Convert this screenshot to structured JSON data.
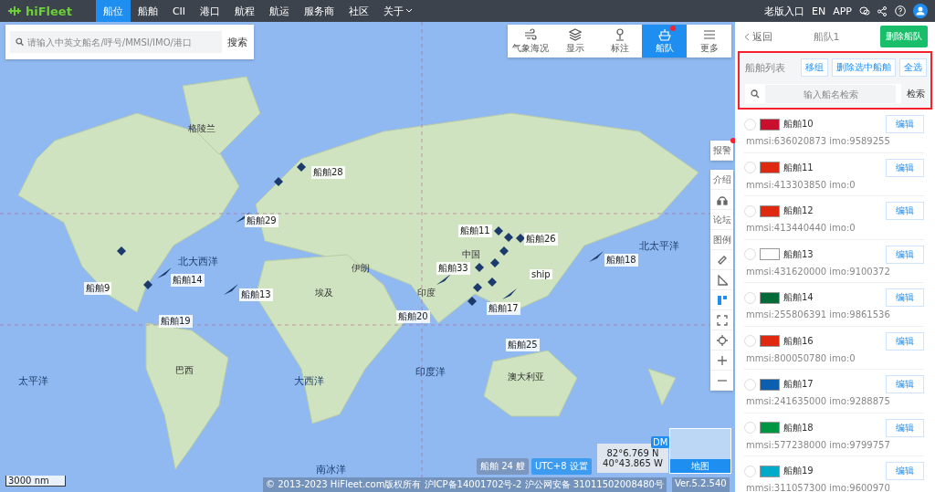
{
  "nav": {
    "logo": "hiFleet",
    "items": [
      {
        "label": "船位",
        "selected": true
      },
      {
        "label": "船舶",
        "selected": false
      },
      {
        "label": "CII",
        "selected": false
      },
      {
        "label": "港口",
        "selected": false
      },
      {
        "label": "航程",
        "selected": false
      },
      {
        "label": "航运",
        "selected": false
      },
      {
        "label": "服务商",
        "selected": false
      },
      {
        "label": "社区",
        "selected": false
      },
      {
        "label": "关于",
        "selected": false
      }
    ],
    "right": [
      "老版入口",
      "EN",
      "APP"
    ]
  },
  "search": {
    "placeholder": "请输入中英文船名/呼号/MMSI/IMO/港口",
    "button": "搜索"
  },
  "tools": [
    {
      "label": "气象海况",
      "selected": false,
      "badge": false
    },
    {
      "label": "显示",
      "selected": false,
      "badge": false
    },
    {
      "label": "标注",
      "selected": false,
      "badge": false
    },
    {
      "label": "船队",
      "selected": true,
      "badge": true
    },
    {
      "label": "更多",
      "selected": false,
      "badge": false
    }
  ],
  "map": {
    "labels": [
      {
        "text": "格陵兰",
        "kind": "land"
      },
      {
        "text": "北大西洋",
        "kind": "ocean"
      },
      {
        "text": "北太平洋",
        "kind": "ocean"
      },
      {
        "text": "太平洋",
        "kind": "ocean"
      },
      {
        "text": "大西洋",
        "kind": "ocean"
      },
      {
        "text": "印度洋",
        "kind": "ocean"
      },
      {
        "text": "南冰洋",
        "kind": "ocean"
      },
      {
        "text": "中国",
        "kind": "land"
      },
      {
        "text": "印度",
        "kind": "land"
      },
      {
        "text": "巴西",
        "kind": "land"
      },
      {
        "text": "澳大利亚",
        "kind": "land"
      },
      {
        "text": "伊朗",
        "kind": "land"
      },
      {
        "text": "埃及",
        "kind": "land"
      }
    ],
    "ships": [
      "船舶28",
      "船舶29",
      "船舶14",
      "船舶9",
      "船舶13",
      "船舶19",
      "船舶11",
      "船舶26",
      "船舶33",
      "ship",
      "船舶18",
      "船舶17",
      "船舶20",
      "船舶25"
    ],
    "side_tools": [
      {
        "label": "报警",
        "kind": "text",
        "badge": true,
        "selected": false
      },
      {
        "label": "介绍",
        "kind": "text",
        "badge": false,
        "selected": false
      },
      {
        "kind": "headset",
        "badge": false,
        "selected": false
      },
      {
        "label": "论坛",
        "kind": "text",
        "badge": false,
        "selected": false
      },
      {
        "label": "图例",
        "kind": "text",
        "badge": false,
        "selected": false
      },
      {
        "kind": "ruler",
        "badge": false,
        "selected": false
      },
      {
        "kind": "triangle",
        "badge": false,
        "selected": false
      },
      {
        "kind": "layout",
        "badge": false,
        "selected": true
      },
      {
        "kind": "expand",
        "badge": false,
        "selected": false
      },
      {
        "kind": "target",
        "badge": false,
        "selected": false
      },
      {
        "kind": "plus",
        "badge": false,
        "selected": false
      },
      {
        "kind": "minus",
        "badge": false,
        "selected": false
      }
    ],
    "scale": "3000 nm",
    "ship_count": "船舶 24 艘",
    "timezone": "UTC+8 设置",
    "coords": [
      "82°6.769 N",
      "40°43.865 W"
    ],
    "coord_mode": "DM",
    "minimap_label": "地图",
    "footer": "© 2013-2023 HiFleet.com版权所有 沪ICP备14001702号-2 沪公网安备 31011502008480号",
    "version": "Ver.5.2.540"
  },
  "panel": {
    "back": "返回",
    "title": "船队1",
    "delete": "删除船队",
    "list_title": "船舶列表",
    "actions": [
      "移组",
      "删除选中船舶",
      "全选"
    ],
    "search_placeholder": "输入船名检索",
    "search_button": "检索",
    "ships": [
      {
        "name": "船舶10",
        "info": "mmsi:636020873 imo:9589255",
        "edit": "编辑",
        "color": "#c8102e",
        "selected": false
      },
      {
        "name": "船舶11",
        "info": "mmsi:413303850 imo:0",
        "edit": "编辑",
        "color": "#de2910",
        "selected": false
      },
      {
        "name": "船舶12",
        "info": "mmsi:413440440 imo:0",
        "edit": "编辑",
        "color": "#de2910",
        "selected": false
      },
      {
        "name": "船舶13",
        "info": "mmsi:431620000 imo:9100372",
        "edit": "编辑",
        "color": "#ffffff",
        "selected": false
      },
      {
        "name": "船舶14",
        "info": "mmsi:255806391 imo:9861536",
        "edit": "编辑",
        "color": "#046a38",
        "selected": false
      },
      {
        "name": "船舶16",
        "info": "mmsi:800050780 imo:0",
        "edit": "编辑",
        "color": "#de2910",
        "selected": false
      },
      {
        "name": "船舶17",
        "info": "mmsi:241635000 imo:9288875",
        "edit": "编辑",
        "color": "#0d5eaf",
        "selected": false
      },
      {
        "name": "船舶18",
        "info": "mmsi:577238000 imo:9799757",
        "edit": "编辑",
        "color": "#009543",
        "selected": false
      },
      {
        "name": "船舶19",
        "info": "mmsi:311057300 imo:9600970",
        "edit": "编辑",
        "color": "#00abc9",
        "selected": false
      }
    ]
  }
}
